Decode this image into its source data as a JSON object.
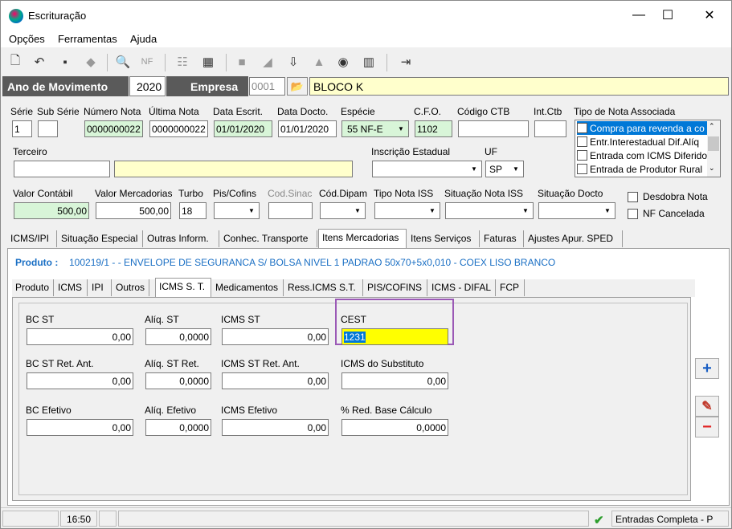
{
  "window": {
    "title": "Escrituração",
    "controls": [
      "—",
      "☐",
      "✕"
    ]
  },
  "menu": [
    {
      "label": "Opções"
    },
    {
      "label": "Ferramentas"
    },
    {
      "label": "Ajuda"
    }
  ],
  "header": {
    "ano_label": "Ano de Movimento",
    "ano_value": "2020",
    "empresa_label": "Empresa",
    "empresa_code": "0001",
    "empresa_name": "BLOCO K"
  },
  "nota": {
    "serie_label": "Série",
    "serie_value": "1",
    "subserie_label": "Sub Série",
    "subserie_value": "",
    "numero_label": "Número Nota",
    "numero_value": "0000000022",
    "ultima_label": "Última Nota",
    "ultima_value": "0000000022",
    "data_escrit_label": "Data Escrit.",
    "data_escrit_value": "01/01/2020",
    "data_docto_label": "Data Docto.",
    "data_docto_value": "01/01/2020",
    "especie_label": "Espécie",
    "especie_value": "55  NF-E",
    "cfo_label": "C.F.O.",
    "cfo_value": "1102",
    "codigo_ctb_label": "Código CTB",
    "codigo_ctb_value": "",
    "int_ctb_label": "Int.Ctb",
    "int_ctb_value": "",
    "tipo_assoc_label": "Tipo de Nota Associada",
    "tipo_assoc_items": [
      "Compra para revenda a co",
      "Entr.Interestadual Dif.Alíq",
      "Entrada com ICMS Diferido",
      "Entrada de Produtor Rural"
    ],
    "terceiro_label": "Terceiro",
    "terceiro_code": "",
    "terceiro_name": "",
    "ie_label": "Inscrição Estadual",
    "ie_value": "",
    "uf_label": "UF",
    "uf_value": "SP",
    "valor_contabil_label": "Valor Contábil",
    "valor_contabil_value": "500,00",
    "valor_merc_label": "Valor Mercadorias",
    "valor_merc_value": "500,00",
    "turbo_label": "Turbo",
    "turbo_value": "18",
    "pis_label": "Pis/Cofins",
    "pis_value": "",
    "cod_sinac_label": "Cod.Sinac",
    "cod_sinac_value": "",
    "cod_dipam_label": "Cód.Dipam",
    "cod_dipam_value": "",
    "tipo_iss_label": "Tipo Nota ISS",
    "tipo_iss_value": "",
    "sit_iss_label": "Situação Nota ISS",
    "sit_iss_value": "",
    "sit_docto_label": "Situação Docto",
    "sit_docto_value": "",
    "desdobra_label": "Desdobra Nota",
    "nf_cancelada_label": "NF Cancelada"
  },
  "main_tabs": [
    "ICMS/IPI",
    "Situação Especial",
    "Outras Inform.",
    "Conhec. Transporte",
    "Itens Mercadorias",
    "Itens Serviços",
    "Faturas",
    "Ajustes Apur. SPED"
  ],
  "produto": {
    "label": "Produto :",
    "value": "100219/1 - - ENVELOPE DE SEGURANCA S/ BOLSA NIVEL 1 PADRAO 50x70+5x0,010 - COEX LISO BRANCO"
  },
  "sub_tabs": [
    "Produto",
    "ICMS",
    "IPI",
    "Outros",
    "ICMS S. T.",
    "Medicamentos",
    "Ress.ICMS S.T.",
    "PIS/COFINS",
    "ICMS - DIFAL",
    "FCP"
  ],
  "st": {
    "bc_st_label": "BC ST",
    "bc_st_value": "0,00",
    "aliq_st_label": "Alíq. ST",
    "aliq_st_value": "0,0000",
    "icms_st_label": "ICMS ST",
    "icms_st_value": "0,00",
    "cest_label": "CEST",
    "cest_value": "1231",
    "bc_st_ret_label": "BC ST Ret. Ant.",
    "bc_st_ret_value": "0,00",
    "aliq_st_ret_label": "Alíq. ST Ret.",
    "aliq_st_ret_value": "0,0000",
    "icms_st_ret_label": "ICMS ST Ret. Ant.",
    "icms_st_ret_value": "0,00",
    "icms_subst_label": "ICMS do Substituto",
    "icms_subst_value": "0,00",
    "bc_efetivo_label": "BC Efetivo",
    "bc_efetivo_value": "0,00",
    "aliq_efetivo_label": "Alíq. Efetivo",
    "aliq_efetivo_value": "0,0000",
    "icms_efetivo_label": "ICMS Efetivo",
    "icms_efetivo_value": "0,00",
    "red_base_label": "% Red. Base Cálculo",
    "red_base_value": "0,0000"
  },
  "status": {
    "time": "16:50",
    "mode": "Entradas Completa - P"
  },
  "colors": {
    "dark": "#5a5a5a",
    "green": "#d8f5d8",
    "yellow": "#ffffcc",
    "highlight": "#ffff00",
    "select": "#0078d7",
    "accent_border": "#9b59b6",
    "link_blue": "#1a6fc4"
  }
}
